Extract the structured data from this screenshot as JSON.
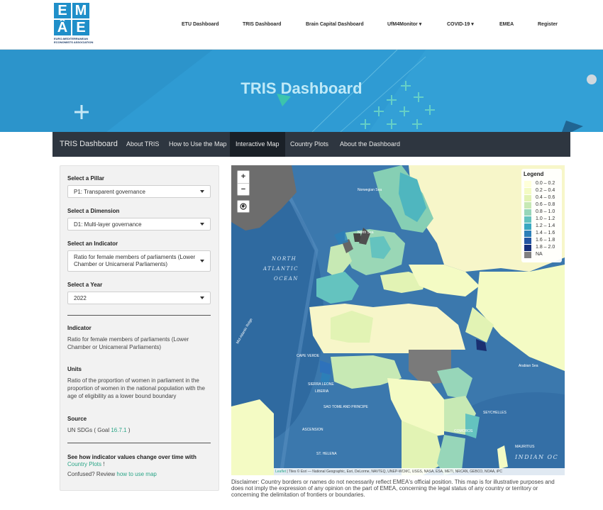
{
  "header": {
    "logo_letters": [
      "E",
      "M",
      "Â",
      "E"
    ],
    "logo_subtitle": "EURO-MEDITERRANEAN ECONOMISTS ASSOCIATION",
    "nav": [
      {
        "label": "ETU Dashboard"
      },
      {
        "label": "TRIS Dashboard"
      },
      {
        "label": "Brain Capital Dashboard"
      },
      {
        "label": "UfM4Monitor ▾"
      },
      {
        "label": "COVID-19 ▾"
      },
      {
        "label": "EMEA"
      },
      {
        "label": "Register"
      }
    ]
  },
  "banner": {
    "title": "TRIS Dashboard"
  },
  "subnav": {
    "brand": "TRIS Dashboard",
    "items": [
      "About TRIS",
      "How to Use the Map",
      "Interactive Map",
      "Country Plots",
      "About the Dashboard"
    ],
    "active": "Interactive Map"
  },
  "sidebar": {
    "pillar_label": "Select a Pillar",
    "pillar_value": "P1: Transparent governance",
    "dimension_label": "Select a Dimension",
    "dimension_value": "D1: Multi-layer governance",
    "indicator_label": "Select an Indicator",
    "indicator_value": "Ratio for female members of parliaments (Lower Chamber or Unicameral Parliaments)",
    "year_label": "Select a Year",
    "year_value": "2022",
    "indicator_heading": "Indicator",
    "indicator_text": "Ratio for female members of parliaments (Lower Chamber or Unicameral Parliaments)",
    "units_heading": "Units",
    "units_text": "Ratio of the proportion of women in parliament in the proportion of women in the national population with the age of eligibility as a lower bound boundary",
    "source_heading": "Source",
    "source_prefix": "UN SDGs ( Goal ",
    "source_goal": "16.7.1",
    "source_suffix": " )",
    "plots_note": "See how indicator values change over time with",
    "plots_link": "Country Plots",
    "plots_suffix": " !",
    "confused_prefix": "Confused? Review ",
    "confused_link": "how to use map"
  },
  "map": {
    "zoom_in": "+",
    "zoom_out": "−",
    "locate_icon": "globe-icon",
    "legend_title": "Legend",
    "legend": [
      {
        "label": "0.0 – 0.2",
        "color": "#ffffd9"
      },
      {
        "label": "0.2 – 0.4",
        "color": "#f4fbc4"
      },
      {
        "label": "0.4 – 0.6",
        "color": "#e2f3b4"
      },
      {
        "label": "0.6 – 0.8",
        "color": "#c7e9b4"
      },
      {
        "label": "0.8 – 1.0",
        "color": "#97d6b9"
      },
      {
        "label": "1.0 – 1.2",
        "color": "#64c3bf"
      },
      {
        "label": "1.2 – 1.4",
        "color": "#3aa8c1"
      },
      {
        "label": "1.4 – 1.6",
        "color": "#2c7fb8"
      },
      {
        "label": "1.6 – 1.8",
        "color": "#2355a2"
      },
      {
        "label": "1.8 – 2.0",
        "color": "#152f7a"
      },
      {
        "label": "NA",
        "color": "#808080"
      }
    ],
    "sea_labels": [
      "NORTH",
      "ATLANTIC",
      "OCEAN",
      "INDIAN OC",
      "Norwegian Sea",
      "North Sea",
      "Arabian Sea",
      "Mid-Atlantic Ridge"
    ],
    "country_labels": [
      "CAPE VERDE",
      "SIERRA LEONE",
      "LIBERIA",
      "SAO TOME AND PRINCIPE",
      "COMOROS",
      "SEYCHELLES",
      "MAURITIUS",
      "ASCENSION",
      "ST. HELENA"
    ],
    "attribution_leaflet": "Leaflet",
    "attribution": " | Tiles © Esri — National Geographic, Esri, DeLorme, NAVTEQ, UNEP-WCMC, USGS, NASA, ESA, METI, NRCAN, GEBCO, NOAA, iPC"
  },
  "disclaimer": "Disclaimer: Country borders or names do not necessarily reflect EMEA's official position. This map is for illustrative purposes and does not imply the expression of any opinion on the part of EMEA, concerning the legal status of any country or territory or concerning the delimitation of frontiers or boundaries.",
  "colors": {
    "accent": "#2aa587",
    "banner": "#2f9bd3",
    "navbar": "#2e3640",
    "ocean": "#3b78ad",
    "na": "#808080"
  }
}
